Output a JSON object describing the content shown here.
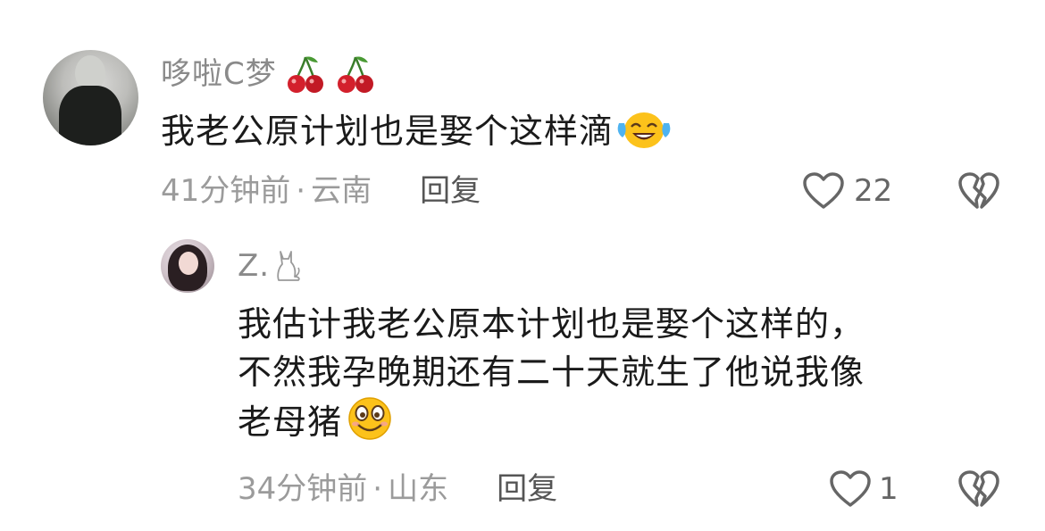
{
  "comments": [
    {
      "username": "哆啦C梦",
      "username_suffix_icon": "cherry-icon",
      "text": "我老公原计划也是娶个这样滴",
      "text_emoji": "laughing-crying-emoji",
      "time": "41分钟前",
      "separator": "·",
      "location": "云南",
      "reply_label": "回复",
      "like_count": "22",
      "like_icon": "heart-outline-icon",
      "dislike_icon": "broken-heart-icon"
    },
    {
      "username": "Z.",
      "username_suffix_icon": "cat-icon",
      "text_lines": [
        "我估计我老公原本计划也是娶个这样的，",
        "不然我孕晚期还有二十天就生了他说我像",
        "老母猪"
      ],
      "text_emoji": "smiley-emoji",
      "time": "34分钟前",
      "separator": "·",
      "location": "山东",
      "reply_label": "回复",
      "like_count": "1",
      "like_icon": "heart-outline-icon",
      "dislike_icon": "broken-heart-icon"
    }
  ],
  "colors": {
    "username": "#8a8a8a",
    "text": "#1a1a1a",
    "meta": "#9b9b9b",
    "reply": "#555555",
    "icon": "#666666",
    "cherry": "#d3202c"
  }
}
